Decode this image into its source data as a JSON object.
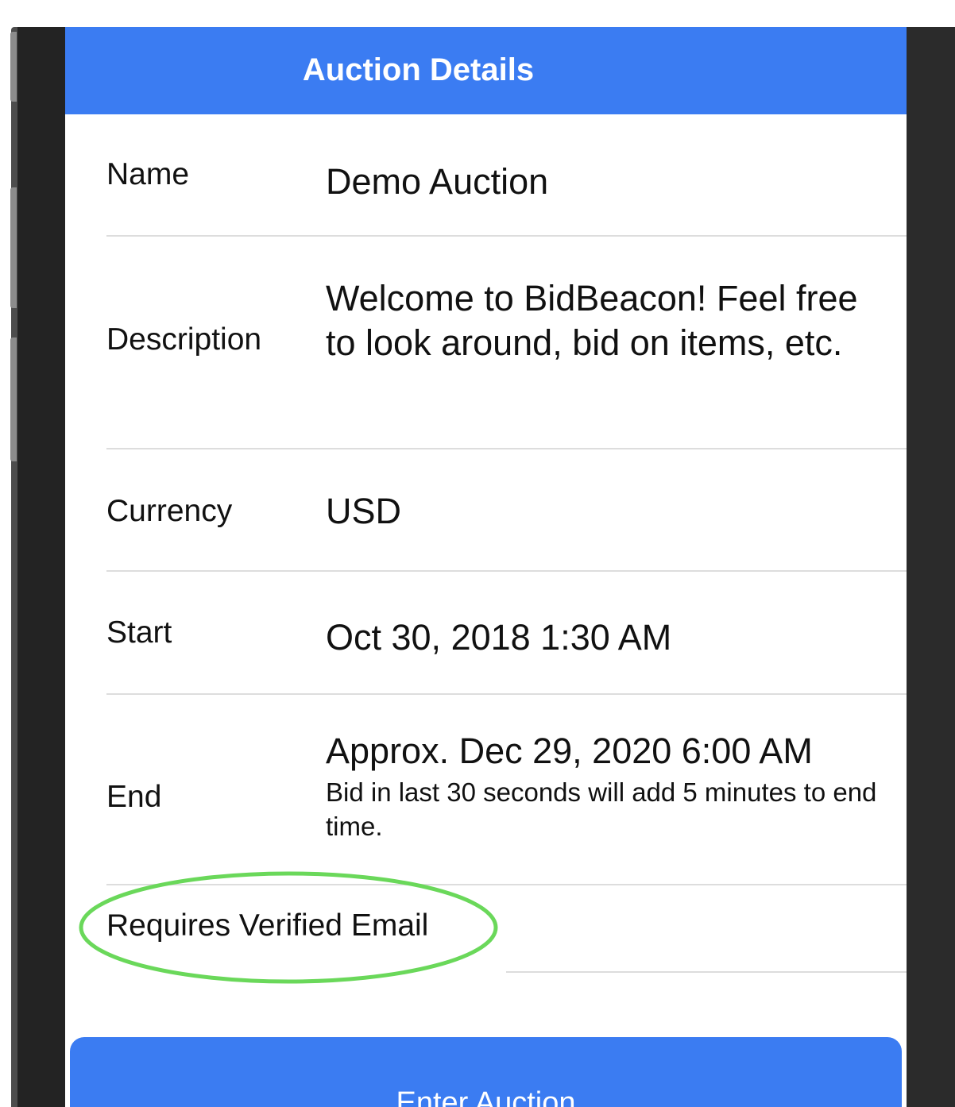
{
  "nav": {
    "title": "Auction Details"
  },
  "details": {
    "name_label": "Name",
    "name_value": "Demo Auction",
    "description_label": "Description",
    "description_value": "Welcome to BidBeacon! Feel free to look around, bid on items, etc.",
    "currency_label": "Currency",
    "currency_value": "USD",
    "start_label": "Start",
    "start_value": "Oct 30, 2018 1:30 AM",
    "end_label": "End",
    "end_value": "Approx. Dec 29, 2020 6:00 AM",
    "end_note": "Bid in last 30 seconds will add 5 minutes to end time.",
    "verified_email_label": "Requires Verified Email"
  },
  "actions": {
    "enter_label": "Enter Auction"
  },
  "colors": {
    "accent": "#3b7cf2",
    "highlight": "#6ad85a",
    "divider": "#dddddd"
  }
}
